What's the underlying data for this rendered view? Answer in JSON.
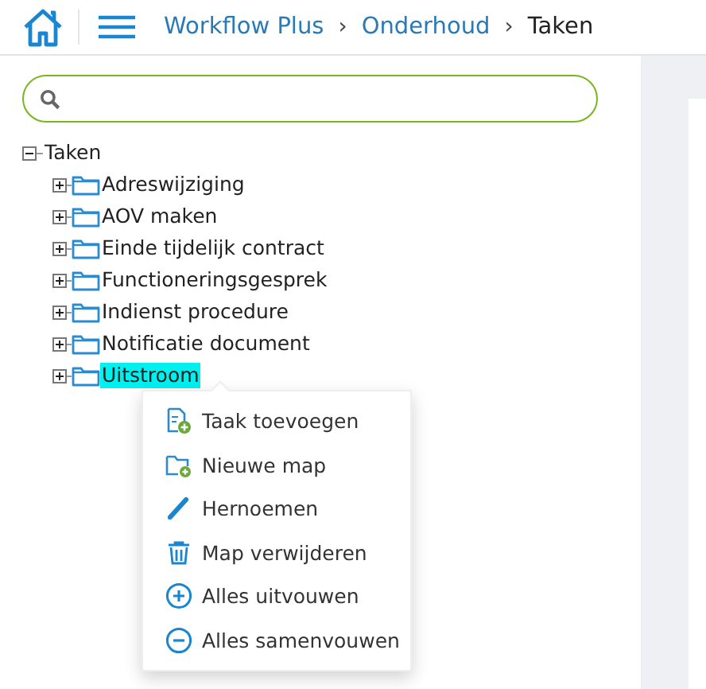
{
  "breadcrumb": [
    {
      "label": "Workflow Plus",
      "current": false
    },
    {
      "label": "Onderhoud",
      "current": false
    },
    {
      "label": "Taken",
      "current": true
    }
  ],
  "breadcrumb_separator": "›",
  "tree": {
    "label": "Taken",
    "expanded": true,
    "selected": false,
    "children": [
      {
        "label": "Adreswijziging",
        "expanded": false,
        "selected": false
      },
      {
        "label": "AOV maken",
        "expanded": false,
        "selected": false
      },
      {
        "label": "Einde tijdelijk contract",
        "expanded": false,
        "selected": false
      },
      {
        "label": "Functioneringsgesprek",
        "expanded": false,
        "selected": false
      },
      {
        "label": "Indienst procedure",
        "expanded": false,
        "selected": false
      },
      {
        "label": "Notificatie document",
        "expanded": false,
        "selected": false
      },
      {
        "label": "Uitstroom",
        "expanded": false,
        "selected": true
      }
    ]
  },
  "context_menu": [
    {
      "label": "Taak toevoegen",
      "kind": "add-task"
    },
    {
      "label": "Nieuwe map",
      "kind": "new-folder"
    },
    {
      "label": "Hernoemen",
      "kind": "rename"
    },
    {
      "label": "Map verwijderen",
      "kind": "delete"
    },
    {
      "label": "Alles uitvouwen",
      "kind": "expand"
    },
    {
      "label": "Alles samenvouwen",
      "kind": "collapse"
    }
  ]
}
